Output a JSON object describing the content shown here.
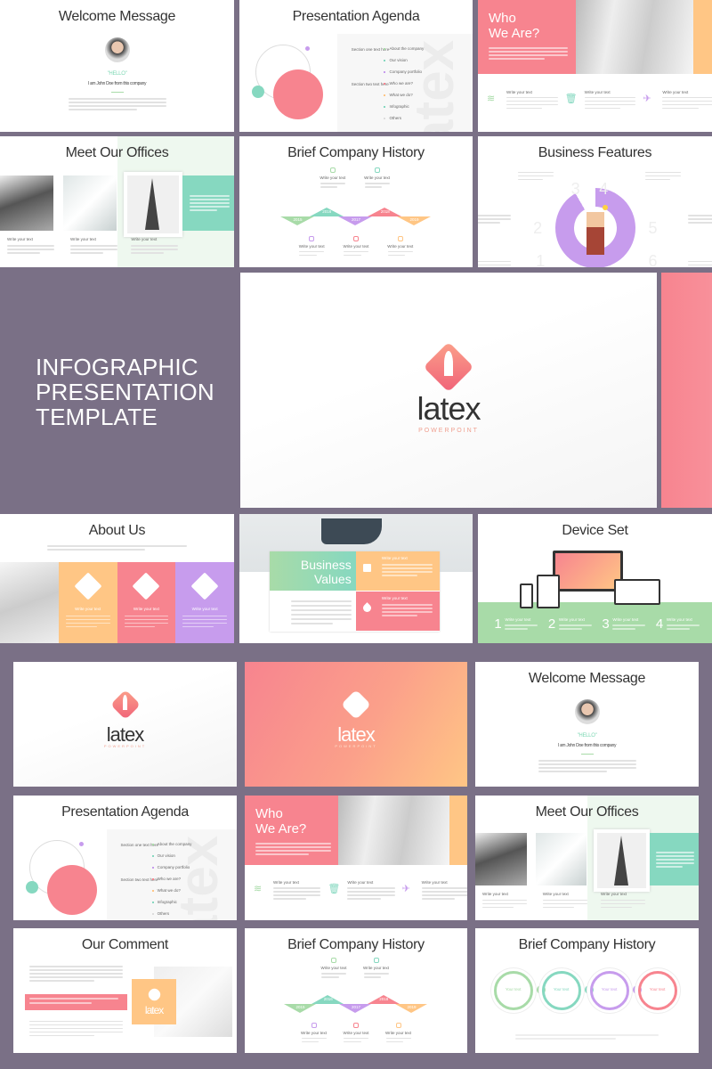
{
  "hero": {
    "title_lines": [
      "INFOGRAPHIC",
      "PRESENTATION",
      "TEMPLATE"
    ],
    "logo_word": "latex",
    "logo_sub": "POWERPOINT"
  },
  "colors": {
    "background": "#7a7086",
    "pink": "#f7848f",
    "orange": "#ffc685",
    "green": "#a8dba8",
    "mint": "#86d8c0",
    "purple": "#c79ced"
  },
  "slides": {
    "welcome": {
      "title": "Welcome Message",
      "hello": "\"HELLO\"",
      "intro": "I am John Doe from this company"
    },
    "agenda": {
      "title": "Presentation Agenda",
      "sections": [
        "Section one text here",
        "Section two text here"
      ],
      "items": [
        "About the company",
        "Our vision",
        "Company portfolio",
        "Who we are?",
        "What we do?",
        "Infographic",
        "Others"
      ],
      "watermark": "latex"
    },
    "who": {
      "title_line1": "Who",
      "title_line2": "We Are?",
      "items": [
        "Write your text",
        "Write your text",
        "Write your text"
      ],
      "icons": [
        "layers-icon",
        "trash-icon",
        "plane-icon"
      ]
    },
    "offices": {
      "title": "Meet Our Offices",
      "items": [
        "Write your text",
        "Write your text",
        "Write your text"
      ]
    },
    "history": {
      "title": "Brief Company History",
      "years": [
        "2015",
        "2016",
        "2017",
        "2018",
        "2019"
      ],
      "items": [
        "Write your text",
        "Write your text",
        "Write your text",
        "Write your text",
        "Write your text"
      ]
    },
    "features": {
      "title": "Business Features",
      "segments": [
        "Write your text",
        "Write your text",
        "Write your text",
        "Write your text",
        "Write your text",
        "Write your text"
      ],
      "numbers": [
        "1",
        "2",
        "3",
        "4",
        "5",
        "6"
      ]
    },
    "about": {
      "title": "About Us",
      "items": [
        "Write your text",
        "Write your text",
        "Write your text"
      ]
    },
    "values": {
      "title_line1": "Business",
      "title_line2": "Values",
      "items": [
        "Write your text",
        "Write your text"
      ]
    },
    "devices": {
      "title": "Device Set",
      "numbers": [
        "1",
        "2",
        "3",
        "4"
      ],
      "items": [
        "Write your text",
        "Write your text",
        "Write your text",
        "Write your text"
      ]
    },
    "comment": {
      "title": "Our Comment"
    },
    "history2": {
      "title": "Brief Company History",
      "items": [
        "Your text",
        "Your text",
        "Your text",
        "Your text"
      ]
    }
  }
}
